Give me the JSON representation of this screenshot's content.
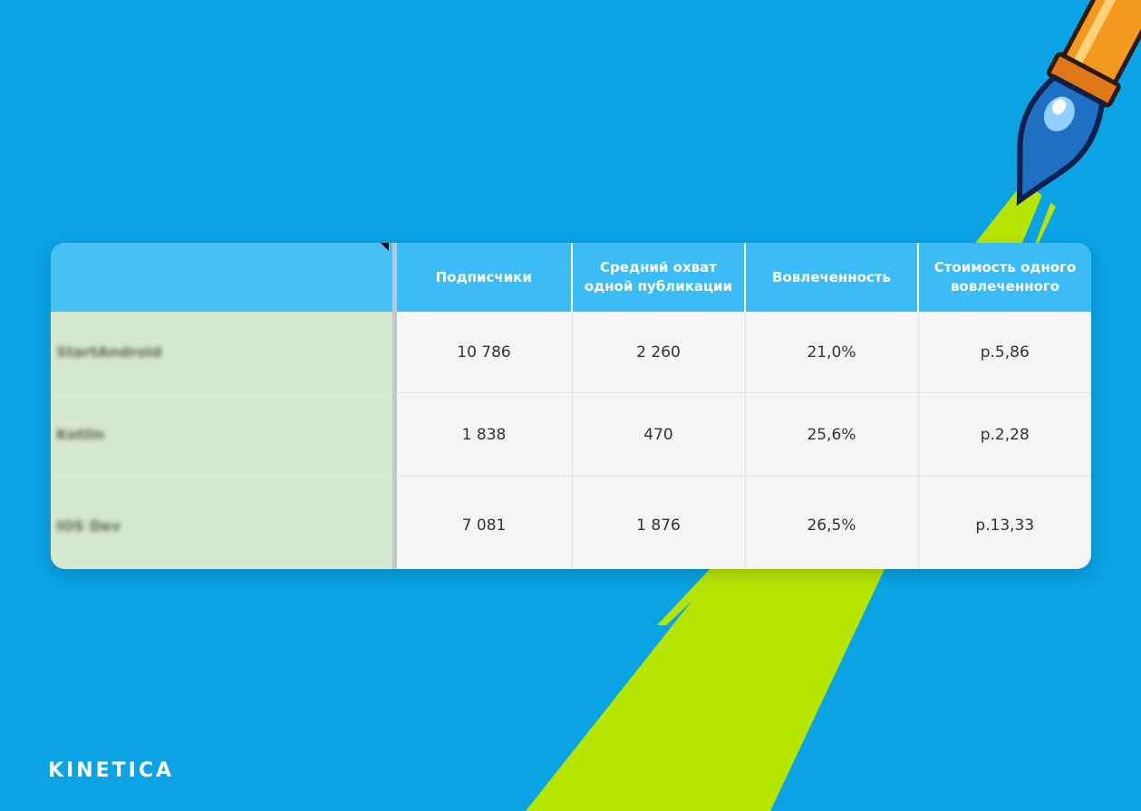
{
  "table": {
    "headers": [
      "",
      "Подписчики",
      "Средний охват одной публикации",
      "Вовлеченность",
      "Стоимость одного вовлеченного"
    ],
    "rows": [
      {
        "name": "StartAndroid",
        "subscribers": "10 786",
        "reach": "2 260",
        "engagement": "21,0%",
        "cost": "р.5,86"
      },
      {
        "name": "Kotlin",
        "subscribers": "1 838",
        "reach": "470",
        "engagement": "25,6%",
        "cost": "р.2,28"
      },
      {
        "name": "IOS Dev",
        "subscribers": "7 081",
        "reach": "1 876",
        "engagement": "26,5%",
        "cost": "р.13,33"
      }
    ]
  },
  "brand": {
    "logo": "KINETICA"
  },
  "colors": {
    "background": "#0aa3e6",
    "header": "#3bbcf6",
    "name_column": "#d7e8d0",
    "accent_stripe": "#b6e600",
    "pen_body": "#f39a1e"
  },
  "icons": [
    "fountain-pen-icon"
  ]
}
